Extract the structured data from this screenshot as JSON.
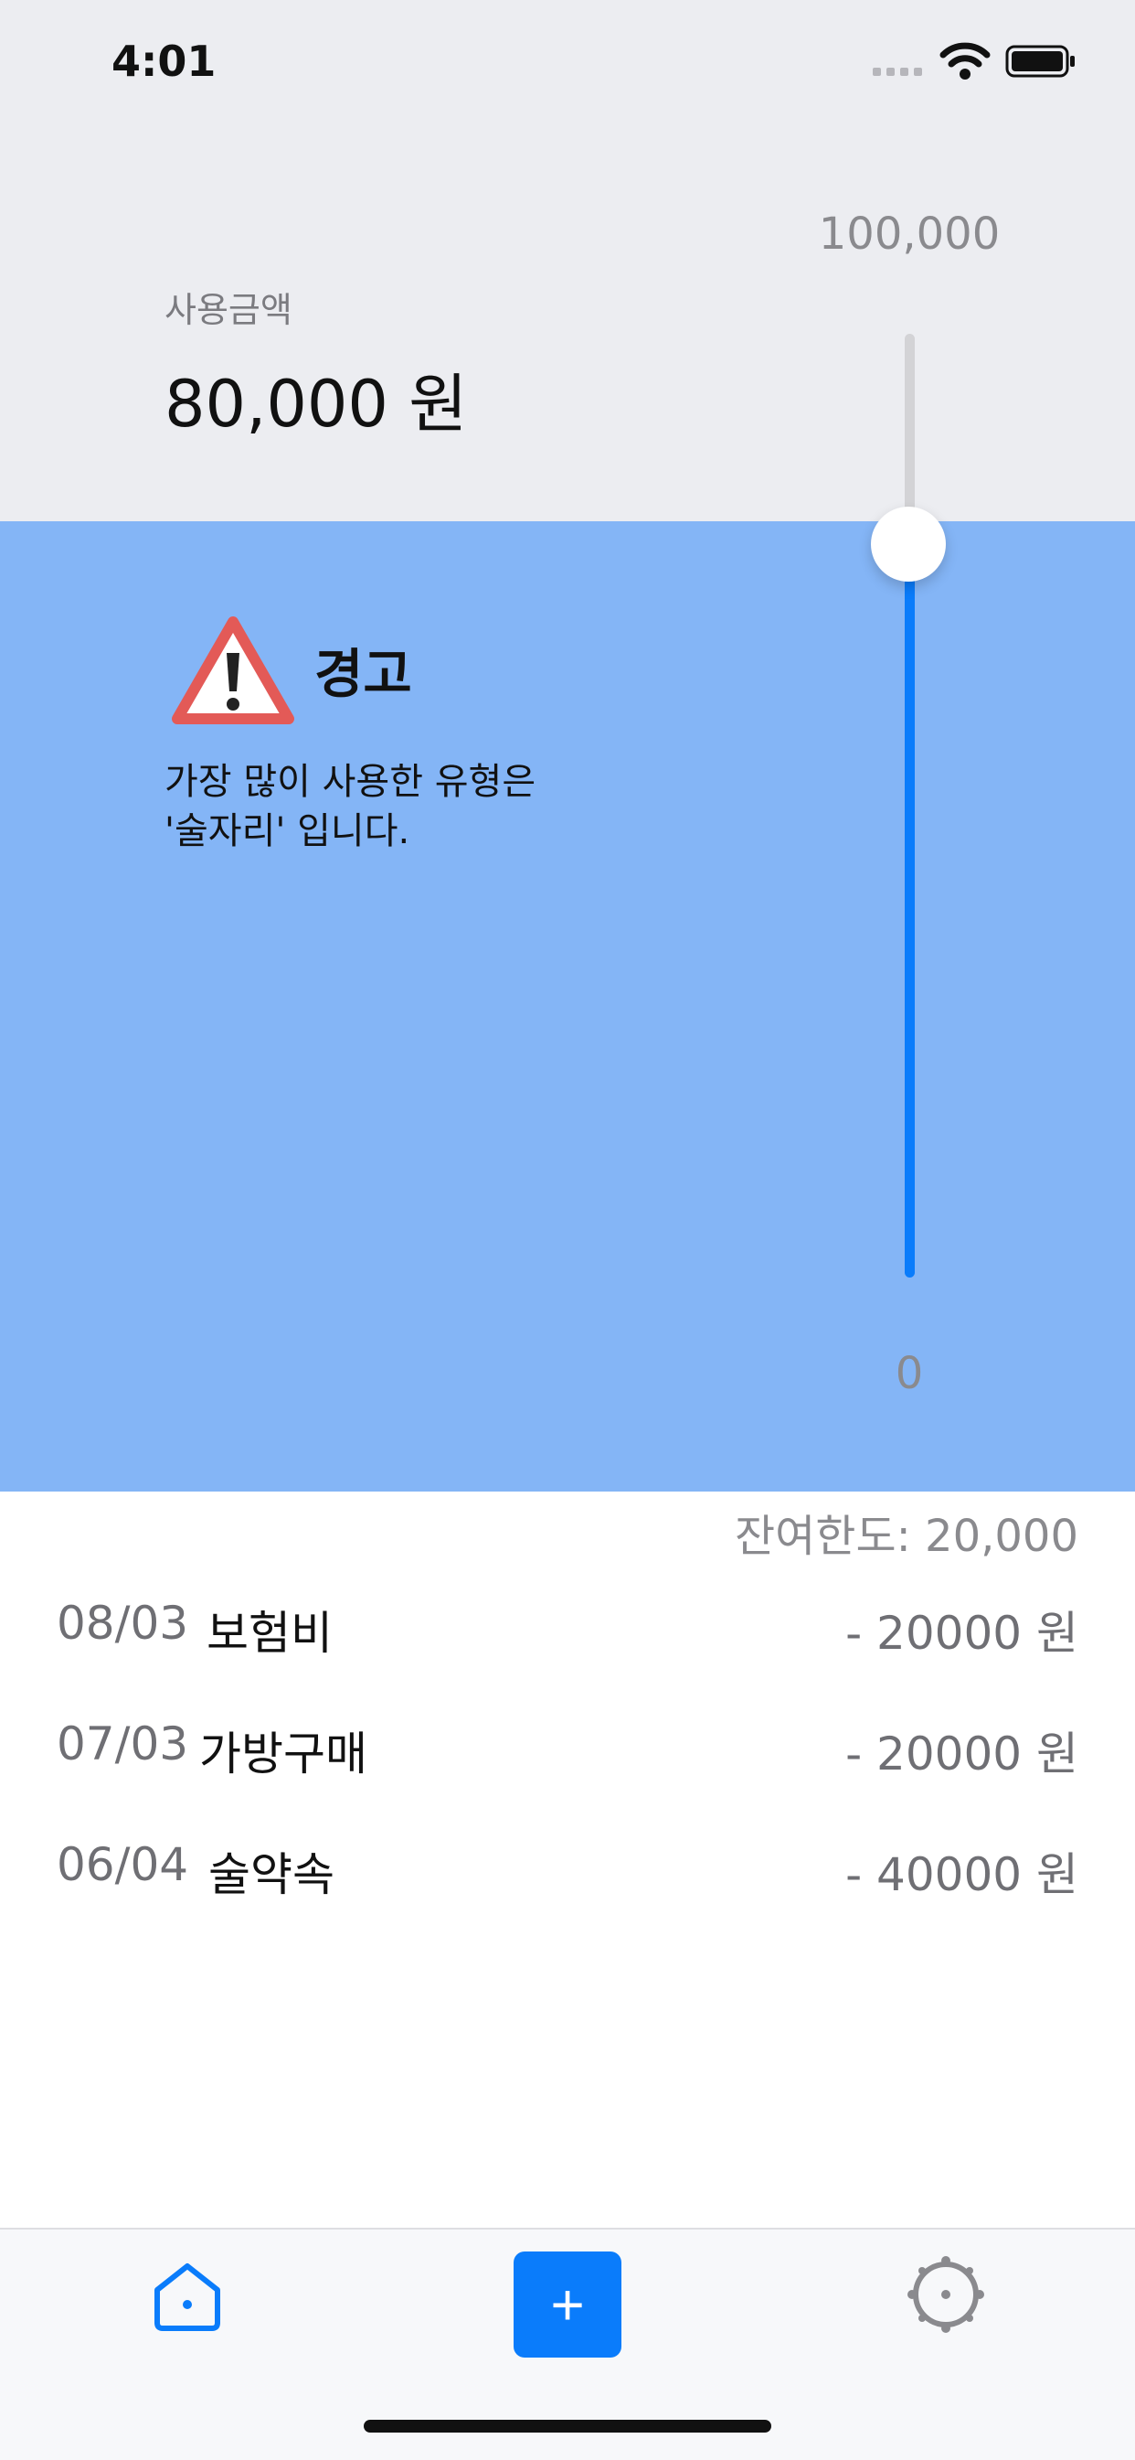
{
  "status_bar": {
    "time": "4:01",
    "icons": [
      "signal-icon",
      "wifi-icon",
      "battery-icon"
    ]
  },
  "gauge": {
    "max_label": "100,000",
    "min_label": "0",
    "spent_label": "사용금액",
    "spent_amount": "80,000 원",
    "level_fraction": 0.8,
    "track_color": "#0a7cfb",
    "fill_color": "#84b5f6"
  },
  "warning": {
    "icon": "warning-triangle-icon",
    "title": "경고",
    "line1": "가장 많이 사용한 유형은",
    "line2": "'술자리' 입니다."
  },
  "remaining": "잔여한도: 20,000",
  "transactions": [
    {
      "date": "08/03",
      "name": "보험비",
      "amount": "- 20000 원"
    },
    {
      "date": "07/03",
      "name": "가방구매",
      "amount": "- 20000 원"
    },
    {
      "date": "06/04",
      "name": "술약속",
      "amount": "- 40000 원"
    }
  ],
  "tabbar": {
    "home_icon": "home-icon",
    "add_label": "+",
    "settings_icon": "settings-icon",
    "accent": "#0a7cfb"
  }
}
